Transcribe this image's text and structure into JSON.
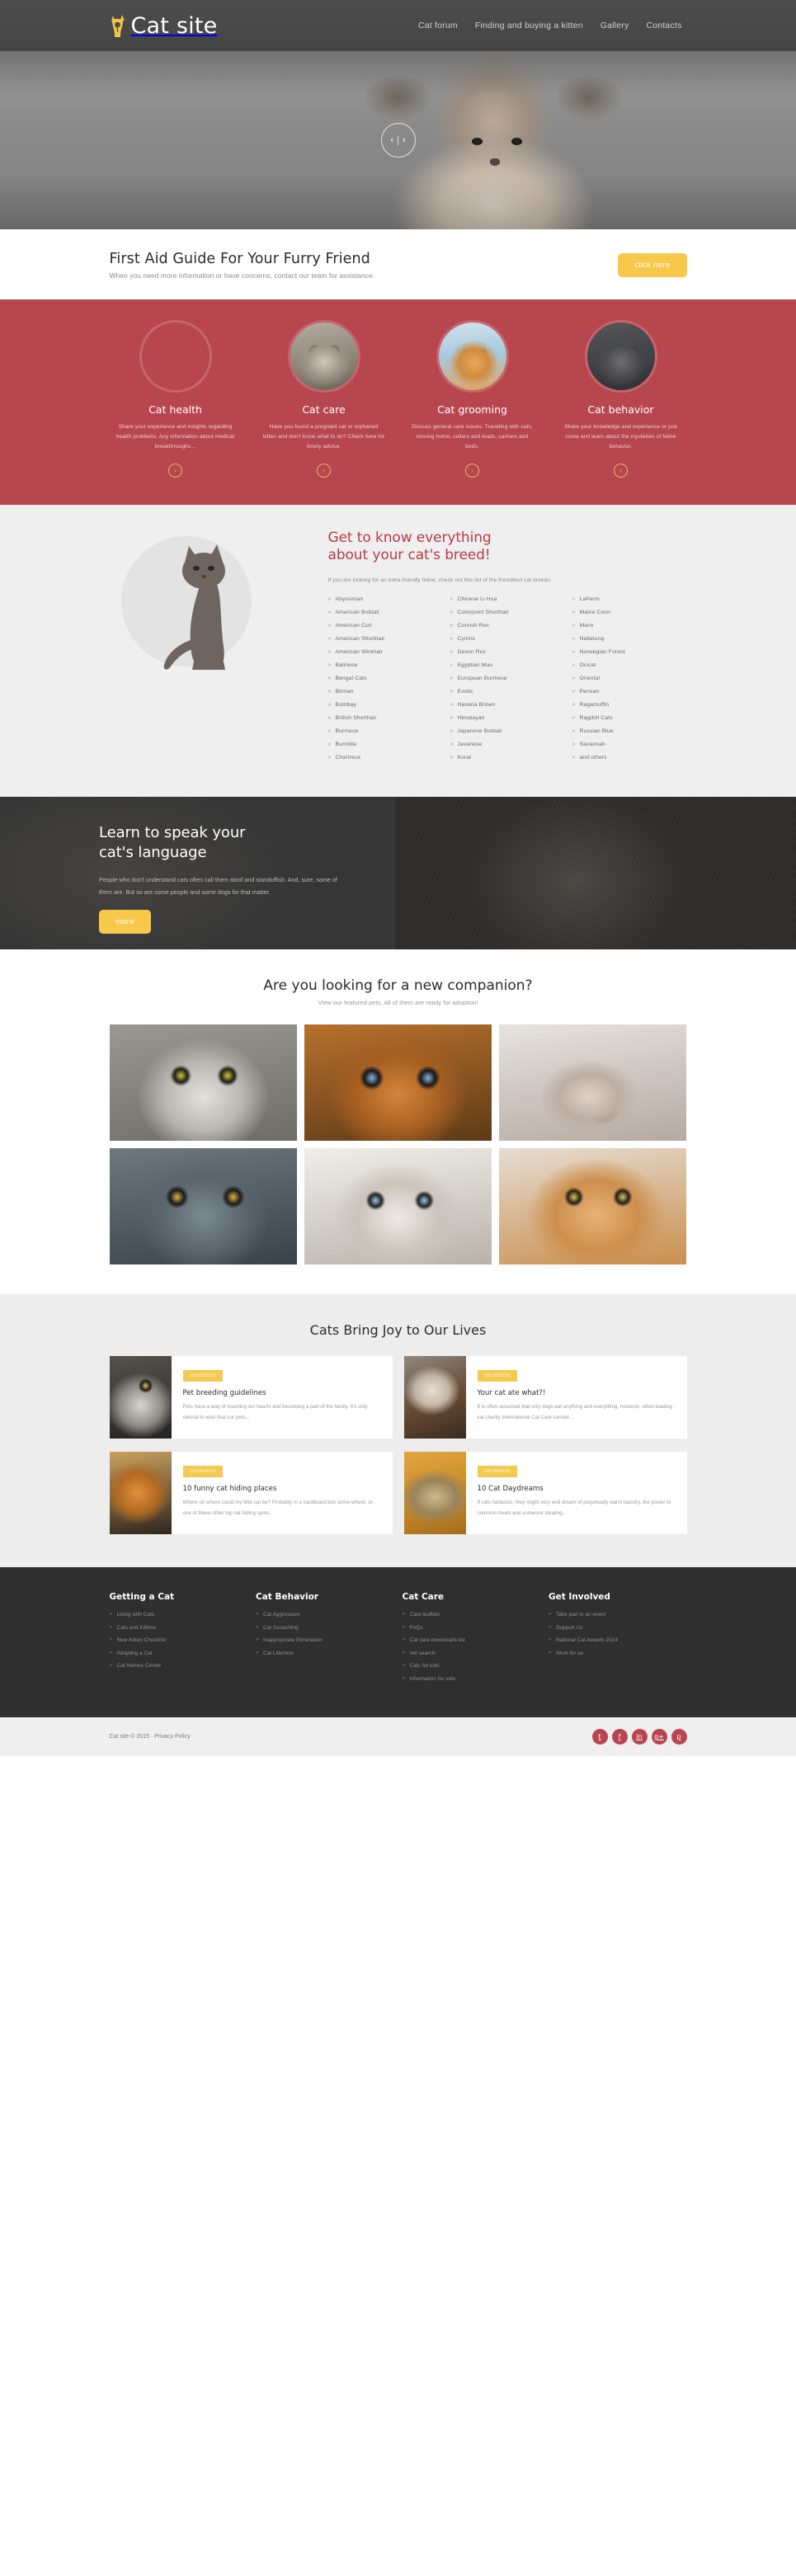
{
  "header": {
    "logo_text": "Cat site",
    "logo_icon": "cat-logo-icon",
    "nav": [
      {
        "label": "Cat forum"
      },
      {
        "label": "Finding and buying a kitten"
      },
      {
        "label": "Gallery"
      },
      {
        "label": "Contacts"
      }
    ]
  },
  "hero": {
    "prev_icon": "chevron-left-icon",
    "next_icon": "chevron-right-icon"
  },
  "callout": {
    "title": "First Aid Guide For Your Furry Friend",
    "subtitle": "When you need more information or have concerns, contact our team for assistance.",
    "button": "click here"
  },
  "services": [
    {
      "title": "Cat health",
      "text": "Share your experience and insights regarding health problems. Any information about medical breakthroughs...",
      "arrow": "›"
    },
    {
      "title": "Cat care",
      "text": "Have you found a pregnant cat or orphaned kitten and don't know what to do? Check here for timely advice.",
      "arrow": "›"
    },
    {
      "title": "Cat grooming",
      "text": "Discuss general care issues. Traveling with cats, moving home, collars and leads, carriers and beds.",
      "arrow": "›"
    },
    {
      "title": "Cat behavior",
      "text": "Share your knowledge and experience or just come and learn about the mysteries of feline behavior.",
      "arrow": "›"
    }
  ],
  "breeds": {
    "title_line1": "Get to know everything",
    "title_line2": "about your cat's breed!",
    "lead": "If you are looking for an extra-friendly feline, check out this list of the friendliest cat breeds.",
    "columns": [
      [
        "Abyssinian",
        "American Bobtail",
        "American Curl",
        "American Shorthair",
        "American Wirehair",
        "Balinese",
        "Bengal Cats",
        "Birman",
        "Bombay",
        "British Shorthair",
        "Burmese",
        "Burmilla",
        "Chartreux"
      ],
      [
        "Chinese Li Hua",
        "Colorpoint Shorthair",
        "Cornish Rex",
        "Cymric",
        "Devon Rex",
        "Egyptian Mau",
        "European Burmese",
        "Exotic",
        "Havana Brown",
        "Himalayan",
        "Japanese Bobtail",
        "Javanese",
        "Korat"
      ],
      [
        "LaPerm",
        "Maine Coon",
        "Manx",
        "Nebelung",
        "Norwegian Forest",
        "Ocicat",
        "Oriental",
        "Persian",
        "Ragamuffin",
        "Ragdoll Cats",
        "Russian Blue",
        "Savannah",
        "and others"
      ]
    ]
  },
  "language": {
    "title_line1": "Learn to speak your",
    "title_line2": "cat's language",
    "text": "People who don't understand cats often call them aloof and standoffish. And, sure, some of them are. But so are some people and some dogs for that matter.",
    "button": "more"
  },
  "gallery": {
    "title": "Are you looking for a new companion?",
    "subtitle": "View our featured pets. All of them are ready for adoption!",
    "items": [
      {
        "alt": "gray-tabby-cat-photo"
      },
      {
        "alt": "orange-kitten-blue-eyes-photo"
      },
      {
        "alt": "sphynx-cat-yawning-photo"
      },
      {
        "alt": "gray-cat-yellow-eyes-photo"
      },
      {
        "alt": "white-cat-blue-eyes-photo"
      },
      {
        "alt": "ginger-tabby-cat-photo"
      }
    ]
  },
  "blog": {
    "title": "Cats Bring Joy to Our Lives",
    "posts": [
      {
        "date": "19/10/2015",
        "title": "Pet breeding guidelines",
        "text": "Pets have a way of touching our hearts and becoming a part of the family. It's only natural to wish that our pets..."
      },
      {
        "date": "19/10/2015",
        "title": "Your cat ate what?!",
        "text": "It is often assumed that only dogs eat anything and everything, however, when leading cat charity International Cat Care carried..."
      },
      {
        "date": "19/10/2015",
        "title": "10 funny cat hiding places",
        "text": "Where oh where could my little cat be? Probably in a cardboard box some-where, or one of these other top cat hiding spots..."
      },
      {
        "date": "19/10/2015",
        "title": "10 Cat Daydreams",
        "text": "If cats fantasize, they might very well dream of perpetually warm laundry, the power to summon treats and someone stealing..."
      }
    ]
  },
  "footer": {
    "columns": [
      {
        "heading": "Getting a Cat",
        "links": [
          "Living with Cats",
          "Cats and Kittens",
          "New Kitten Checklist",
          "Adopting a Cat",
          "Cat Names Center"
        ]
      },
      {
        "heading": "Cat Behavior",
        "links": [
          "Cat Aggression",
          "Cat Scratching",
          "Inappropriate Elimination",
          "Cat Litterbox"
        ]
      },
      {
        "heading": "Cat Care",
        "links": [
          "Care leaflets",
          "FAQs",
          "Cat care downloads list",
          "Vet search",
          "Cats for kids",
          "Information for vets"
        ]
      },
      {
        "heading": "Get Involved",
        "links": [
          "Take part in an event",
          "Support Us",
          "National Cat Awards 2014",
          "Work for us"
        ]
      }
    ],
    "copyright": "Cat site © 2015 · Privacy Policy",
    "socials": [
      {
        "name": "twitter-icon",
        "glyph": "t"
      },
      {
        "name": "facebook-icon",
        "glyph": "f"
      },
      {
        "name": "linkedin-icon",
        "glyph": "in"
      },
      {
        "name": "googleplus-icon",
        "glyph": "g+"
      },
      {
        "name": "pinterest-icon",
        "glyph": "p"
      }
    ]
  },
  "colors": {
    "accent_yellow": "#f7c84a",
    "accent_red": "#b8464f",
    "dark": "#2f2f2f",
    "light_gray": "#efefef"
  }
}
